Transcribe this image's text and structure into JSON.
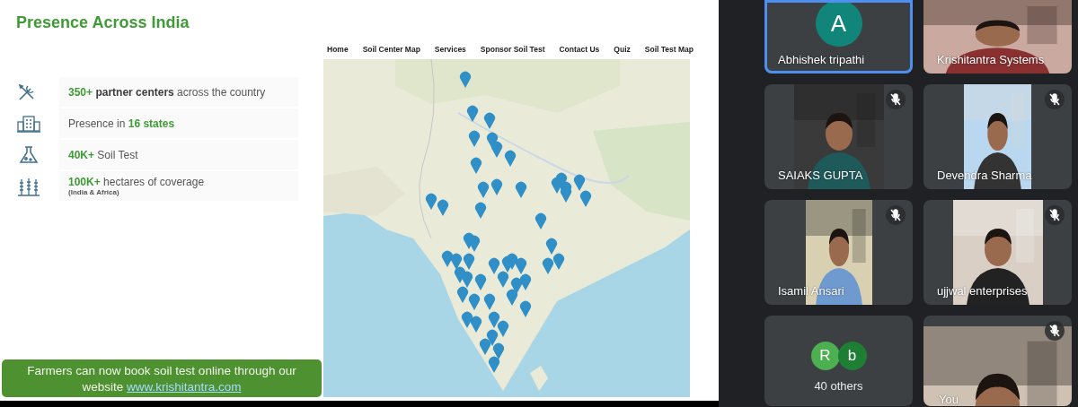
{
  "slide": {
    "title": "Presence Across India",
    "stats": [
      {
        "kind": "value-first",
        "value": "350+",
        "text": "**partner centers** across the country"
      },
      {
        "kind": "value-last",
        "value": "16 states",
        "text": "Presence in"
      },
      {
        "kind": "value-first",
        "value": "40K+",
        "text": "Soil Test"
      },
      {
        "kind": "value-first",
        "value": "100K+",
        "text": "hectares of coverage",
        "note": "(India & Africa)"
      }
    ],
    "banner": {
      "text": "Farmers can now book soil test online through our website",
      "link": "www.krishitantra.com"
    },
    "nav": [
      "Home",
      "Soil Center Map",
      "Services",
      "Sponsor Soil Test",
      "Contact Us",
      "Quiz",
      "Soil Test Map"
    ]
  },
  "participants": [
    {
      "kind": "avatar",
      "name": "Abhishek tripathi",
      "initial": "A",
      "color": "#12857a",
      "speaking": true,
      "muted": false
    },
    {
      "kind": "video",
      "name": "Krishitantra Systems",
      "speaking": false,
      "muted": false
    },
    {
      "kind": "video",
      "name": "SAIAKS GUPTA",
      "speaking": false,
      "muted": true
    },
    {
      "kind": "video",
      "name": "Devendra Sharma",
      "speaking": false,
      "muted": true
    },
    {
      "kind": "video",
      "name": "Isamil Ansari",
      "speaking": false,
      "muted": true
    },
    {
      "kind": "video",
      "name": "ujjwal enterprises",
      "speaking": false,
      "muted": true
    },
    {
      "kind": "others",
      "label": "40 others",
      "avatars": [
        {
          "initial": "R",
          "color": "#4caf50"
        },
        {
          "initial": "b",
          "color": "#1e7e34"
        }
      ],
      "speaking": false,
      "muted": false
    },
    {
      "kind": "video",
      "name": "You",
      "speaking": false,
      "muted": true
    }
  ]
}
